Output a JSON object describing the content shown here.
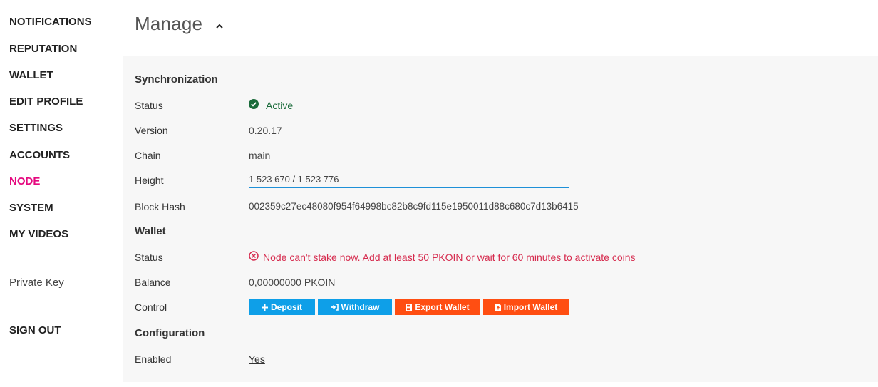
{
  "sidebar": {
    "items": [
      {
        "label": "NOTIFICATIONS"
      },
      {
        "label": "REPUTATION"
      },
      {
        "label": "WALLET"
      },
      {
        "label": "EDIT PROFILE"
      },
      {
        "label": "SETTINGS"
      },
      {
        "label": "ACCOUNTS"
      },
      {
        "label": "NODE",
        "active": true
      },
      {
        "label": "SYSTEM"
      },
      {
        "label": "MY VIDEOS"
      }
    ],
    "private_key": "Private Key",
    "sign_out": "SIGN OUT"
  },
  "header": {
    "title": "Manage",
    "collapse_icon": "chevron-up-icon"
  },
  "synchronization": {
    "title": "Synchronization",
    "status_label": "Status",
    "status_value": "Active",
    "status_icon": "check-circle-icon",
    "version_label": "Version",
    "version_value": "0.20.17",
    "chain_label": "Chain",
    "chain_value": "main",
    "height_label": "Height",
    "height_value": "1 523 670 / 1 523 776",
    "blockhash_label": "Block Hash",
    "blockhash_value": "002359c27ec48080f954f64998bc82b8c9fd115e1950011d88c680c7d13b6415"
  },
  "wallet": {
    "title": "Wallet",
    "status_label": "Status",
    "status_value": "Node can't stake now. Add at least 50 PKOIN or wait for 60 minutes to activate coins",
    "status_icon": "x-circle-icon",
    "balance_label": "Balance",
    "balance_value": "0,00000000 PKOIN",
    "control_label": "Control",
    "buttons": {
      "deposit": "Deposit",
      "withdraw": "Withdraw",
      "export": "Export Wallet",
      "import": "Import Wallet"
    }
  },
  "configuration": {
    "title": "Configuration",
    "enabled_label": "Enabled",
    "enabled_value": "Yes"
  },
  "colors": {
    "active_nav": "#e5097f",
    "status_ok": "#1a6b3a",
    "status_error": "#d62b4e",
    "button_blue": "#0e9fe8",
    "button_orange": "#ff4e12",
    "progress_line": "#1e90d8"
  }
}
